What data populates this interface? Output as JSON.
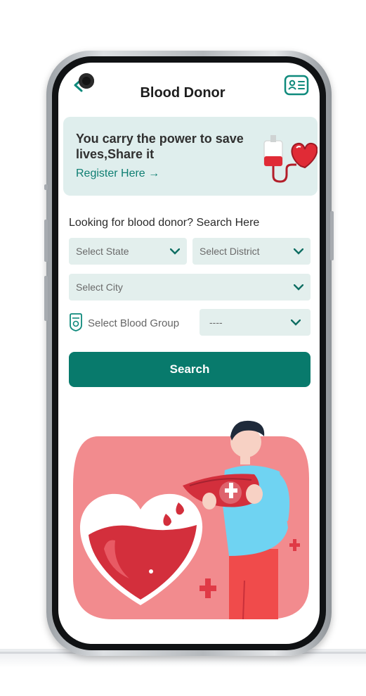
{
  "header": {
    "title": "Blood Donor"
  },
  "banner": {
    "line1": "You carry the power to save",
    "line2": "lives,Share it",
    "register_label": "Register Here →"
  },
  "search_section": {
    "prompt": "Looking for blood donor? Search Here",
    "state_placeholder": "Select State",
    "district_placeholder": "Select District",
    "city_placeholder": "Select City",
    "blood_group_label": "Select Blood Group",
    "blood_group_value": "----",
    "search_button": "Search"
  },
  "colors": {
    "accent": "#087a6c",
    "banner_bg": "#dfeeed",
    "select_bg": "#e3efed",
    "blood_red": "#d32f3c",
    "pink": "#f28b8e"
  }
}
